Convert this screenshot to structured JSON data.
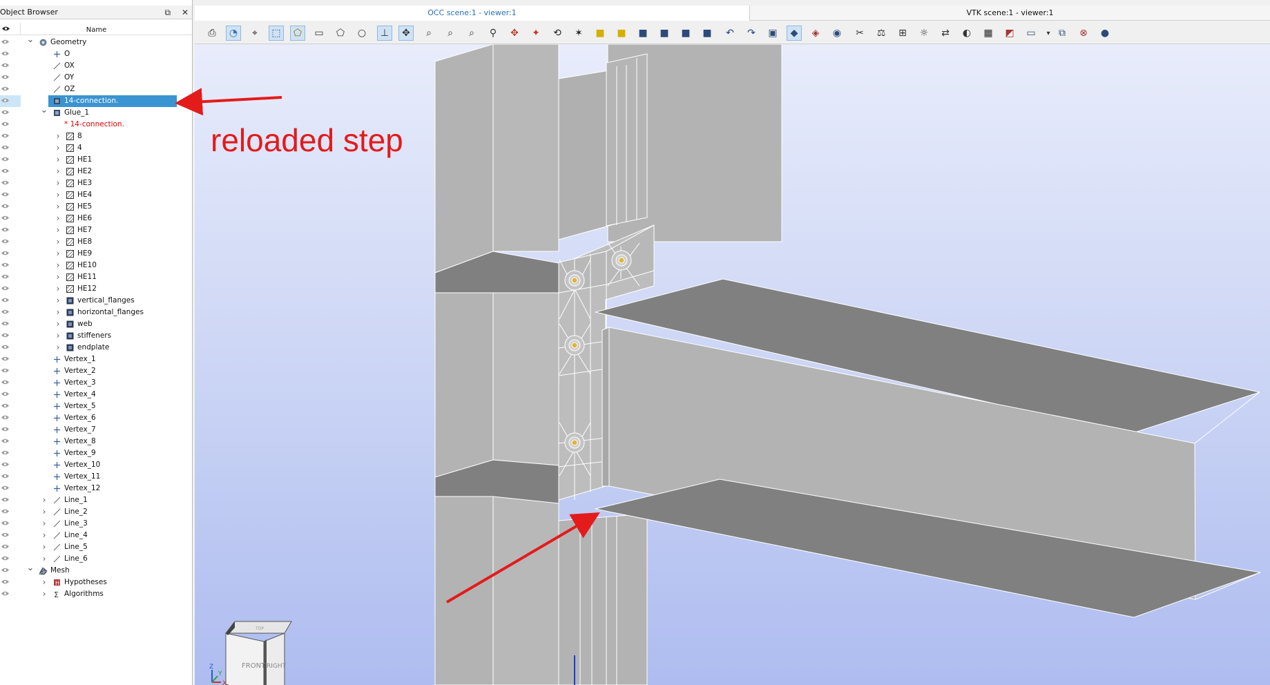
{
  "browser": {
    "title": "Object Browser",
    "column_name": "Name",
    "float_icon": "float-icon",
    "close_icon": "close-icon",
    "rows": [
      {
        "label": "Geometry",
        "level": 0,
        "arrow": "v",
        "icon": "geometry-icon",
        "color": "normal"
      },
      {
        "label": "O",
        "level": 1,
        "arrow": "",
        "icon": "point-icon",
        "color": "normal"
      },
      {
        "label": "OX",
        "level": 1,
        "arrow": "",
        "icon": "line-icon",
        "color": "normal"
      },
      {
        "label": "OY",
        "level": 1,
        "arrow": "",
        "icon": "line-icon",
        "color": "normal"
      },
      {
        "label": "OZ",
        "level": 1,
        "arrow": "",
        "icon": "line-icon",
        "color": "normal"
      },
      {
        "label": "14-connection.",
        "level": 1,
        "arrow": "",
        "icon": "solid-icon",
        "color": "selected"
      },
      {
        "label": "Glue_1",
        "level": 1,
        "arrow": "v",
        "icon": "solid-icon",
        "color": "normal"
      },
      {
        "label": "* 14-connection.",
        "level": 2,
        "arrow": "",
        "icon": "",
        "color": "red"
      },
      {
        "label": "8",
        "level": 2,
        "arrow": ">",
        "icon": "group-icon",
        "color": "normal"
      },
      {
        "label": "4",
        "level": 2,
        "arrow": ">",
        "icon": "group-icon",
        "color": "normal"
      },
      {
        "label": "HE1",
        "level": 2,
        "arrow": ">",
        "icon": "group-icon",
        "color": "normal"
      },
      {
        "label": "HE2",
        "level": 2,
        "arrow": ">",
        "icon": "group-icon",
        "color": "normal"
      },
      {
        "label": "HE3",
        "level": 2,
        "arrow": ">",
        "icon": "group-icon",
        "color": "normal"
      },
      {
        "label": "HE4",
        "level": 2,
        "arrow": ">",
        "icon": "group-icon",
        "color": "normal"
      },
      {
        "label": "HE5",
        "level": 2,
        "arrow": ">",
        "icon": "group-icon",
        "color": "normal"
      },
      {
        "label": "HE6",
        "level": 2,
        "arrow": ">",
        "icon": "group-icon",
        "color": "normal"
      },
      {
        "label": "HE7",
        "level": 2,
        "arrow": ">",
        "icon": "group-icon",
        "color": "normal"
      },
      {
        "label": "HE8",
        "level": 2,
        "arrow": ">",
        "icon": "group-icon",
        "color": "normal"
      },
      {
        "label": "HE9",
        "level": 2,
        "arrow": ">",
        "icon": "group-icon",
        "color": "normal"
      },
      {
        "label": "HE10",
        "level": 2,
        "arrow": ">",
        "icon": "group-icon",
        "color": "normal"
      },
      {
        "label": "HE11",
        "level": 2,
        "arrow": ">",
        "icon": "group-icon",
        "color": "normal"
      },
      {
        "label": "HE12",
        "level": 2,
        "arrow": ">",
        "icon": "group-icon",
        "color": "normal"
      },
      {
        "label": "vertical_flanges",
        "level": 2,
        "arrow": ">",
        "icon": "solid-group-icon",
        "color": "normal"
      },
      {
        "label": "horizontal_flanges",
        "level": 2,
        "arrow": ">",
        "icon": "solid-group-icon",
        "color": "normal"
      },
      {
        "label": "web",
        "level": 2,
        "arrow": ">",
        "icon": "solid-group-icon",
        "color": "normal"
      },
      {
        "label": "stiffeners",
        "level": 2,
        "arrow": ">",
        "icon": "solid-group-icon",
        "color": "normal"
      },
      {
        "label": "endplate",
        "level": 2,
        "arrow": ">",
        "icon": "solid-group-icon",
        "color": "normal"
      },
      {
        "label": "Vertex_1",
        "level": 1,
        "arrow": "",
        "icon": "point-icon",
        "color": "normal"
      },
      {
        "label": "Vertex_2",
        "level": 1,
        "arrow": "",
        "icon": "point-icon",
        "color": "normal"
      },
      {
        "label": "Vertex_3",
        "level": 1,
        "arrow": "",
        "icon": "point-icon",
        "color": "normal"
      },
      {
        "label": "Vertex_4",
        "level": 1,
        "arrow": "",
        "icon": "point-icon",
        "color": "normal"
      },
      {
        "label": "Vertex_5",
        "level": 1,
        "arrow": "",
        "icon": "point-icon",
        "color": "normal"
      },
      {
        "label": "Vertex_6",
        "level": 1,
        "arrow": "",
        "icon": "point-icon",
        "color": "normal"
      },
      {
        "label": "Vertex_7",
        "level": 1,
        "arrow": "",
        "icon": "point-icon",
        "color": "normal"
      },
      {
        "label": "Vertex_8",
        "level": 1,
        "arrow": "",
        "icon": "point-icon",
        "color": "normal"
      },
      {
        "label": "Vertex_9",
        "level": 1,
        "arrow": "",
        "icon": "point-icon",
        "color": "normal"
      },
      {
        "label": "Vertex_10",
        "level": 1,
        "arrow": "",
        "icon": "point-icon",
        "color": "normal"
      },
      {
        "label": "Vertex_11",
        "level": 1,
        "arrow": "",
        "icon": "point-icon",
        "color": "normal"
      },
      {
        "label": "Vertex_12",
        "level": 1,
        "arrow": "",
        "icon": "point-icon",
        "color": "normal"
      },
      {
        "label": "Line_1",
        "level": 1,
        "arrow": ">",
        "icon": "line-icon",
        "color": "normal"
      },
      {
        "label": "Line_2",
        "level": 1,
        "arrow": ">",
        "icon": "line-icon",
        "color": "normal"
      },
      {
        "label": "Line_3",
        "level": 1,
        "arrow": ">",
        "icon": "line-icon",
        "color": "normal"
      },
      {
        "label": "Line_4",
        "level": 1,
        "arrow": ">",
        "icon": "line-icon",
        "color": "normal"
      },
      {
        "label": "Line_5",
        "level": 1,
        "arrow": ">",
        "icon": "line-icon",
        "color": "normal"
      },
      {
        "label": "Line_6",
        "level": 1,
        "arrow": ">",
        "icon": "line-icon",
        "color": "normal"
      },
      {
        "label": "Mesh",
        "level": 0,
        "arrow": "v",
        "icon": "mesh-icon",
        "color": "normal"
      },
      {
        "label": "Hypotheses",
        "level": 1,
        "arrow": ">",
        "icon": "hypotheses-icon",
        "color": "normal"
      },
      {
        "label": "Algorithms",
        "level": 1,
        "arrow": ">",
        "icon": "algorithms-icon",
        "color": "normal"
      }
    ]
  },
  "viewer": {
    "tab_occ": "OCC scene:1 - viewer:1",
    "tab_vtk": "VTK scene:1 - viewer:1",
    "toolbar_icons": [
      "dump-view-icon",
      "interaction-style-icon",
      "zooming-style-icon",
      "rectangle-select-icon",
      "polygon-select-icon",
      "rect-icon",
      "polygon-icon",
      "circle-icon",
      "show-trihedron-icon",
      "global-pan-icon",
      "fit-all-icon",
      "fit-area-icon",
      "fit-selection-icon",
      "zoom-icon",
      "pan-icon",
      "rotation-icon",
      "rotation-point-icon",
      "global-rotation-icon",
      "front-view-icon",
      "back-view-icon",
      "top-view-icon",
      "bottom-view-icon",
      "left-view-icon",
      "right-view-icon",
      "anticlockwise-icon",
      "clockwise-icon",
      "reset-view-icon",
      "perspective-icon",
      "ortho-icon",
      "stereo-icon",
      "clipping-icon",
      "scaling-icon",
      "graduated-axes-icon",
      "ambient-light-icon",
      "sync-view-icon",
      "shadows-icon",
      "background-icon",
      "view-cube-icon",
      "maximize-icon",
      "dropdown-icon",
      "clone-view-icon",
      "erase-all-icon",
      "sphere-icon"
    ],
    "view_cube": {
      "front": "FRONT",
      "right": "RIGHT",
      "top": "TOP"
    },
    "axes": {
      "z": "Z",
      "y": "Y",
      "x": "X"
    }
  },
  "annotation": {
    "text": "reloaded step",
    "color": "#e31b1b"
  },
  "colors": {
    "selection": "#3a94d1",
    "steel_light": "#b3b3b3",
    "steel_dark": "#7f7f7f",
    "steel_mid": "#999999",
    "bolt": "#e3b43a"
  }
}
